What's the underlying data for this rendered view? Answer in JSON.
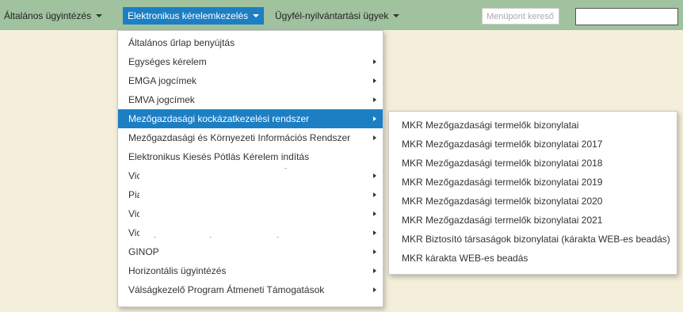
{
  "nav": {
    "items": [
      {
        "label": "Általános ügyintézés"
      },
      {
        "label": "Elektronikus kérelemkezelés"
      },
      {
        "label": "Ügyfél-nyilvántartási ügyek"
      }
    ],
    "menu_search_placeholder": "Menüpont kereső",
    "active_color": "#1c7fc4",
    "bar_color": "#a0c29f"
  },
  "dropdown": {
    "items": [
      {
        "label": "Általános űrlap benyújtás",
        "has_submenu": false
      },
      {
        "label": "Egységes kérelem",
        "has_submenu": true
      },
      {
        "label": "EMGA jogcímek",
        "has_submenu": true
      },
      {
        "label": "EMVA jogcímek",
        "has_submenu": true
      },
      {
        "label": "Mezőgazdasági kockázatkezelési rendszer",
        "has_submenu": true,
        "active": true
      },
      {
        "label": "Mezőgazdasági és Környezeti Információs Rendszer",
        "has_submenu": true
      },
      {
        "label": "Elektronikus Kiesés Pótlás Kérelem indítás",
        "has_submenu": false
      },
      {
        "label": "Vic",
        "has_submenu": true
      },
      {
        "label": "Pia",
        "has_submenu": true
      },
      {
        "label": "Vic",
        "has_submenu": true
      },
      {
        "label": "Vic",
        "has_submenu": true
      },
      {
        "label": "GINOP",
        "has_submenu": true
      },
      {
        "label": "Horizontális ügyintézés",
        "has_submenu": true
      },
      {
        "label": "Válságkezelő Program Átmeneti Támogatások",
        "has_submenu": true
      }
    ]
  },
  "submenu": {
    "items": [
      {
        "label": "MKR Mezőgazdasági termelők bizonylatai"
      },
      {
        "label": "MKR Mezőgazdasági termelők bizonylatai 2017"
      },
      {
        "label": "MKR Mezőgazdasági termelők bizonylatai 2018"
      },
      {
        "label": "MKR Mezőgazdasági termelők bizonylatai 2019"
      },
      {
        "label": "MKR Mezőgazdasági termelők bizonylatai 2020"
      },
      {
        "label": "MKR Mezőgazdasági termelők bizonylatai 2021"
      },
      {
        "label": "MKR Biztosító társaságok bizonylatai (kárakta WEB-es beadás)"
      },
      {
        "label": "MKR kárakta WEB-es beadás"
      }
    ]
  }
}
